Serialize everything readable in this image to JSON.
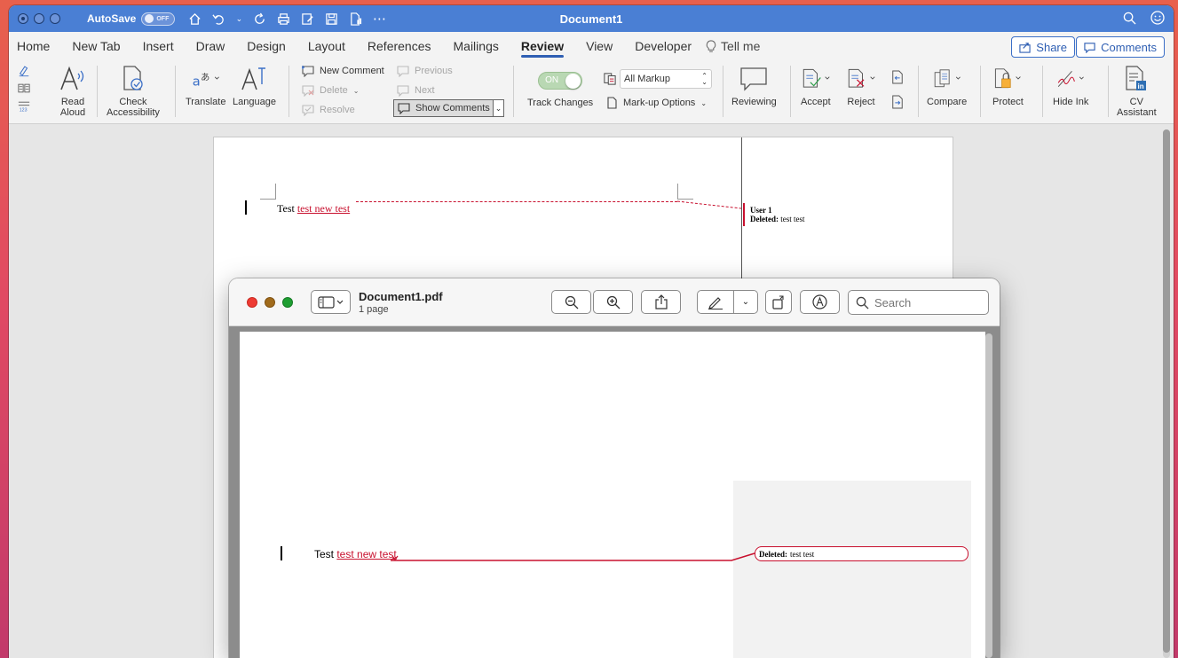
{
  "word": {
    "title": "Document1",
    "autosave_label": "AutoSave",
    "autosave_state": "OFF",
    "tabs": [
      "Home",
      "New Tab",
      "Insert",
      "Draw",
      "Design",
      "Layout",
      "References",
      "Mailings",
      "Review",
      "View",
      "Developer"
    ],
    "active_tab": "Review",
    "tell_me": "Tell me",
    "share_label": "Share",
    "comments_label": "Comments",
    "ribbon": {
      "read_aloud": "Read\nAloud",
      "read_aloud_l1": "Read",
      "read_aloud_l2": "Aloud",
      "check_l1": "Check",
      "check_l2": "Accessibility",
      "translate": "Translate",
      "language": "Language",
      "new_comment": "New Comment",
      "delete": "Delete",
      "resolve": "Resolve",
      "previous": "Previous",
      "next": "Next",
      "show_comments": "Show Comments",
      "track_on": "ON",
      "track_changes": "Track Changes",
      "all_markup": "All Markup",
      "markup_options": "Mark-up Options",
      "reviewing": "Reviewing",
      "accept": "Accept",
      "reject": "Reject",
      "compare": "Compare",
      "protect": "Protect",
      "hide_ink": "Hide Ink",
      "cv_l1": "CV",
      "cv_l2": "Assistant"
    },
    "document": {
      "text_plain": "Test ",
      "text_inserted": "test new test",
      "balloon_user": "User 1",
      "balloon_deleted_label": "Deleted:",
      "balloon_deleted_text": "test test"
    }
  },
  "preview": {
    "filename": "Document1.pdf",
    "pages": "1 page",
    "search_placeholder": "Search",
    "text_plain": "Test ",
    "text_inserted": "test new test",
    "balloon_deleted_label": "Deleted:",
    "balloon_deleted_text": "test test"
  },
  "colors": {
    "word_blue": "#4a7fd4",
    "track_red": "#c8102e"
  }
}
